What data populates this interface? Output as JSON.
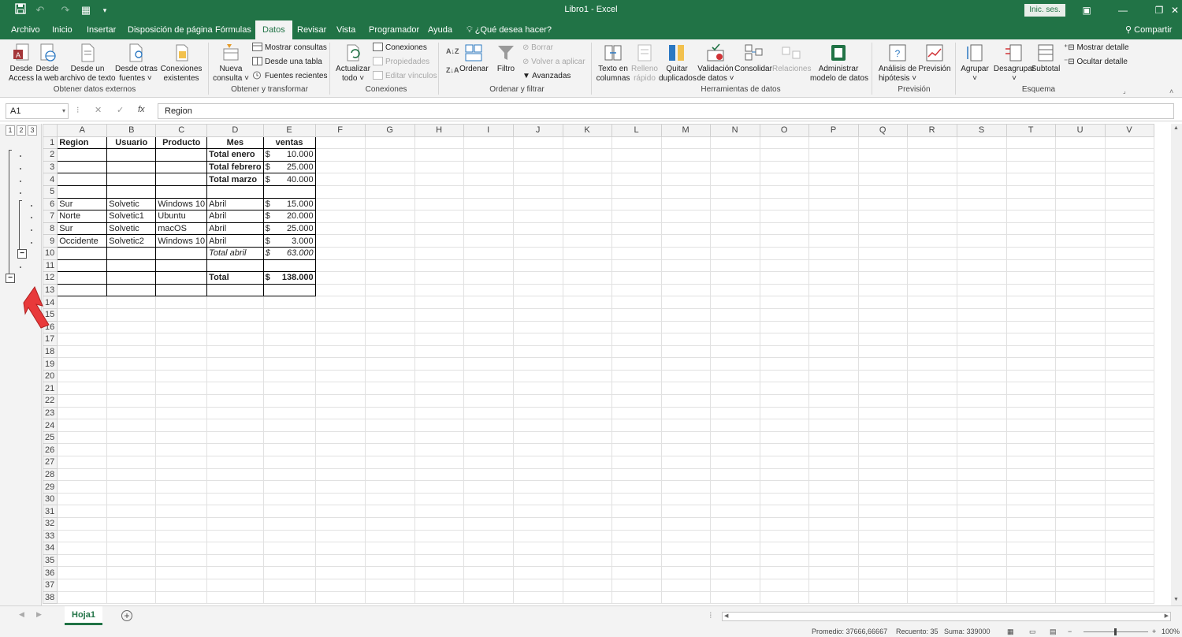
{
  "window": {
    "title": "Libro1 - Excel",
    "signin": "Inic. ses.",
    "share": "Compartir"
  },
  "tabs": [
    "Archivo",
    "Inicio",
    "Insertar",
    "Disposición de página",
    "Fórmulas",
    "Datos",
    "Revisar",
    "Vista",
    "Programador",
    "Ayuda"
  ],
  "active_tab": "Datos",
  "tell_me": "¿Qué desea hacer?",
  "ribbon": {
    "external": {
      "label": "Obtener datos externos",
      "access": [
        "Desde",
        "Access"
      ],
      "web": [
        "Desde",
        "la web"
      ],
      "text": [
        "Desde un",
        "archivo de texto"
      ],
      "other": [
        "Desde otras",
        "fuentes ˅"
      ],
      "existing": [
        "Conexiones",
        "existentes"
      ]
    },
    "transform": {
      "label": "Obtener y transformar",
      "new_query": [
        "Nueva",
        "consulta ˅"
      ],
      "show_queries": "Mostrar consultas",
      "from_table": "Desde una tabla",
      "recent": "Fuentes recientes"
    },
    "connections": {
      "label": "Conexiones",
      "refresh": [
        "Actualizar",
        "todo ˅"
      ],
      "connections": "Conexiones",
      "properties": "Propiedades",
      "edit_links": "Editar vínculos"
    },
    "sort": {
      "label": "Ordenar y filtrar",
      "sort": "Ordenar",
      "filter": "Filtro",
      "clear": "Borrar",
      "reapply": "Volver a aplicar",
      "advanced": "Avanzadas"
    },
    "tools": {
      "label": "Herramientas de datos",
      "text_cols": [
        "Texto en",
        "columnas"
      ],
      "flash": [
        "Relleno",
        "rápido"
      ],
      "dupes": [
        "Quitar",
        "duplicados"
      ],
      "validation": [
        "Validación",
        "de datos ˅"
      ],
      "consolidate": "Consolidar",
      "relations": "Relaciones",
      "model": [
        "Administrar",
        "modelo de datos"
      ]
    },
    "forecast": {
      "label": "Previsión",
      "whatif": [
        "Análisis de",
        "hipótesis ˅"
      ],
      "forecast": "Previsión"
    },
    "outline": {
      "label": "Esquema",
      "group": [
        "Agrupar",
        "˅"
      ],
      "ungroup": [
        "Desagrupar",
        "˅"
      ],
      "subtotal": "Subtotal",
      "show_detail": "Mostrar detalle",
      "hide_detail": "Ocultar detalle"
    }
  },
  "formula_bar": {
    "name_box": "A1",
    "fx": "fx",
    "formula": "Region"
  },
  "outline_levels": [
    "1",
    "2",
    "3"
  ],
  "columns": [
    "A",
    "B",
    "C",
    "D",
    "E",
    "F",
    "G",
    "H",
    "I",
    "J",
    "K",
    "L",
    "M",
    "N",
    "O",
    "P",
    "Q",
    "R",
    "S",
    "T",
    "U",
    "V"
  ],
  "rows": [
    {
      "n": "1",
      "a": "Region",
      "b": "Usuario",
      "c": "Producto",
      "d": "Mes",
      "cur": "",
      "e": "ventas",
      "style": "header"
    },
    {
      "n": "2",
      "a": "",
      "b": "",
      "c": "",
      "d": "Total enero",
      "cur": "$",
      "e": "10.000",
      "style": "total"
    },
    {
      "n": "3",
      "a": "",
      "b": "",
      "c": "",
      "d": "Total febrero",
      "cur": "$",
      "e": "25.000",
      "style": "total"
    },
    {
      "n": "4",
      "a": "",
      "b": "",
      "c": "",
      "d": "Total marzo",
      "cur": "$",
      "e": "40.000",
      "style": "total"
    },
    {
      "n": "5",
      "a": "",
      "b": "",
      "c": "",
      "d": "",
      "cur": "",
      "e": "",
      "style": "plain"
    },
    {
      "n": "6",
      "a": "Sur",
      "b": "Solvetic",
      "c": "Windows 10",
      "d": "Abril",
      "cur": "$",
      "e": "15.000",
      "style": "plain"
    },
    {
      "n": "7",
      "a": "Norte",
      "b": "Solvetic1",
      "c": "Ubuntu",
      "d": "Abril",
      "cur": "$",
      "e": "20.000",
      "style": "plain"
    },
    {
      "n": "8",
      "a": "Sur",
      "b": "Solvetic",
      "c": "macOS",
      "d": "Abril",
      "cur": "$",
      "e": "25.000",
      "style": "plain"
    },
    {
      "n": "9",
      "a": "Occidente",
      "b": "Solvetic2",
      "c": "Windows 10",
      "d": "Abril",
      "cur": "$",
      "e": "3.000",
      "style": "plain"
    },
    {
      "n": "10",
      "a": "",
      "b": "",
      "c": "",
      "d": "Total abril",
      "cur": "$",
      "e": "63.000",
      "style": "italic"
    },
    {
      "n": "11",
      "a": "",
      "b": "",
      "c": "",
      "d": "",
      "cur": "",
      "e": "",
      "style": "plain"
    },
    {
      "n": "12",
      "a": "",
      "b": "",
      "c": "",
      "d": "Total",
      "cur": "$",
      "e": "138.000",
      "style": "total"
    },
    {
      "n": "13",
      "a": "",
      "b": "",
      "c": "",
      "d": "",
      "cur": "",
      "e": "",
      "style": "plain"
    }
  ],
  "empty_row_numbers": [
    "14",
    "15",
    "16",
    "17",
    "18",
    "19",
    "20",
    "21",
    "22",
    "23",
    "24",
    "25",
    "26",
    "27",
    "28",
    "29",
    "30",
    "31",
    "32",
    "33",
    "34",
    "35",
    "36",
    "37",
    "38"
  ],
  "sheet_tab": "Hoja1",
  "status": {
    "average": "Promedio: 37666,66667",
    "count": "Recuento: 35",
    "sum": "Suma: 339000",
    "zoom": "100%"
  },
  "colors": {
    "accent": "#217346",
    "arrow": "#e8393a"
  }
}
